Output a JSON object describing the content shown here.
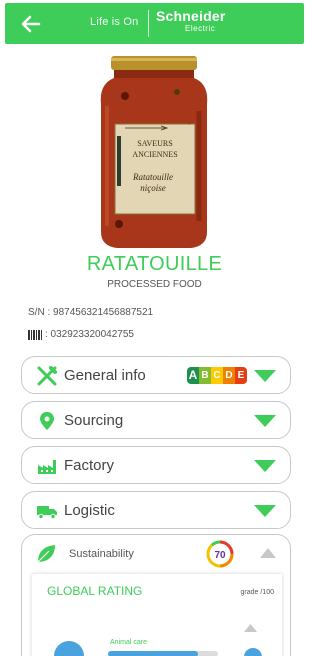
{
  "header": {
    "tagline": "Life is On",
    "brand_line1": "Schneider",
    "brand_line2": "Electric",
    "accent": "#3dcd58"
  },
  "product": {
    "jar_label_line1": "SAVEURS",
    "jar_label_line2": "ANCIENNES",
    "jar_label_line3": "Ratatouille",
    "jar_label_line4": "niçoise",
    "name": "RATATOUILLE",
    "category": "PROCESSED FOOD",
    "serial": "S/N : 987456321456887521",
    "barcode": ": 032923320042755"
  },
  "sections": [
    {
      "label": "General info",
      "icon": "fork-knife-icon"
    },
    {
      "label": "Sourcing",
      "icon": "location-pin-icon"
    },
    {
      "label": "Factory",
      "icon": "factory-icon"
    },
    {
      "label": "Logistic",
      "icon": "truck-icon"
    }
  ],
  "nutriscore": {
    "letters": [
      "A",
      "B",
      "C",
      "D",
      "E"
    ],
    "colors": [
      "#1e8f4e",
      "#85bb2f",
      "#fecb02",
      "#ee8100",
      "#e63e11"
    ],
    "selected": "A"
  },
  "sustainability": {
    "label": "Sustainability",
    "badge": "70",
    "global_rating_title": "GLOBAL RATING",
    "grade_label": "grade /100",
    "animal_care_label": "Animal care",
    "animal_care_fraction": 0.82
  }
}
